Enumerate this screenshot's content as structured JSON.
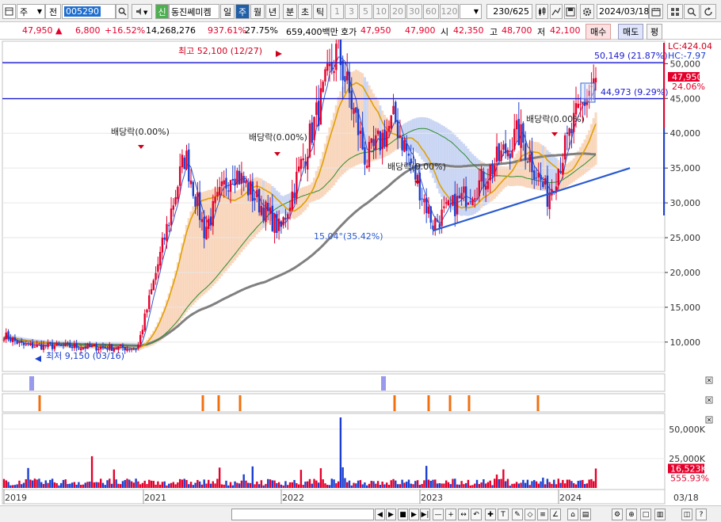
{
  "toolbar": {
    "market": "주",
    "type": "전",
    "code": "005290",
    "badge": "신",
    "stock_name": "동진쎄미켐",
    "periods": [
      "일",
      "주",
      "월",
      "년",
      "분",
      "초",
      "틱"
    ],
    "active_period": "주",
    "intervals": [
      "1",
      "3",
      "5",
      "10",
      "20",
      "30",
      "60",
      "120"
    ],
    "count": "230/625",
    "date": "2024/03/18"
  },
  "quote": {
    "price": "47,950",
    "arrow": "▲",
    "change": "6,800",
    "change_pct": "+16.52%",
    "volume": "14,268,276",
    "volume_ratio": "937.61%",
    "turnover": "27.75%",
    "amount": "659,400백만",
    "ask_label": "호가",
    "ask": "47,950",
    "bid": "47,900",
    "open_label": "시",
    "open": "42,350",
    "high_label": "고",
    "high": "48,700",
    "low_label": "저",
    "low": "42,100",
    "buy_label": "매수",
    "sell_label": "매도",
    "eval_label": "평"
  },
  "price_axis": {
    "ticks": [
      "50,000",
      "45,000",
      "40,000",
      "35,000",
      "30,000",
      "25,000",
      "20,000",
      "15,000",
      "10,000"
    ],
    "lc": "LC:424.04",
    "hc": "HC:-7.97",
    "current": "47,950",
    "current_pct": "24.06%"
  },
  "annotations": {
    "high": "최고 52,100 (12/27)",
    "low": "최저 9,150 (03/16)",
    "line1": "50,149 (21.87%)",
    "line2": "44,973 (9.29%)",
    "trend": "15.04°(35.42%)",
    "dividend": [
      "배당락(0.00%)",
      "배당락(0.00%)",
      "배당락(0.00%)",
      "배당락(0.00%)"
    ]
  },
  "volume_axis": {
    "ticks": [
      "50,000K",
      "25,000K"
    ],
    "current": "16,523K",
    "current_pct": "555.93%"
  },
  "x_axis": {
    "labels": [
      "2019",
      "2021",
      "2022",
      "2023",
      "2024"
    ],
    "current": "03/18"
  },
  "colors": {
    "up": "#e4002b",
    "down": "#1a3fd0",
    "ma_gray": "#808080",
    "ma_orange": "#e0a000",
    "ma_green": "#2e8b2e",
    "cloud_orange": "#f6c9a6",
    "cloud_blue": "#b8c8f0"
  },
  "chart_data": {
    "type": "candlestick",
    "title": "",
    "period": "weekly",
    "price_range": [
      6000,
      53000
    ],
    "series_key_points": [
      {
        "date": "2019-01",
        "close": 11000
      },
      {
        "date": "2019-03",
        "close": 9500
      },
      {
        "date": "2020-03",
        "close": 9150,
        "note": "최저"
      },
      {
        "date": "2020-08",
        "close": 37000
      },
      {
        "date": "2020-10",
        "close": 26000
      },
      {
        "date": "2021-01",
        "close": 35000
      },
      {
        "date": "2021-06",
        "close": 26000
      },
      {
        "date": "2021-12",
        "close": 52100,
        "note": "최고"
      },
      {
        "date": "2022-03",
        "close": 36000
      },
      {
        "date": "2022-06",
        "close": 42000
      },
      {
        "date": "2022-10",
        "close": 27000
      },
      {
        "date": "2023-03",
        "close": 33000
      },
      {
        "date": "2023-07",
        "close": 40000
      },
      {
        "date": "2023-10",
        "close": 31000
      },
      {
        "date": "2024-01",
        "close": 42000
      },
      {
        "date": "2024-03",
        "close": 47950
      }
    ],
    "horizontal_lines": [
      50149,
      44973
    ],
    "trendline": {
      "from": [
        "2022-10",
        26000
      ],
      "to": [
        "2024-05",
        35000
      ]
    }
  }
}
